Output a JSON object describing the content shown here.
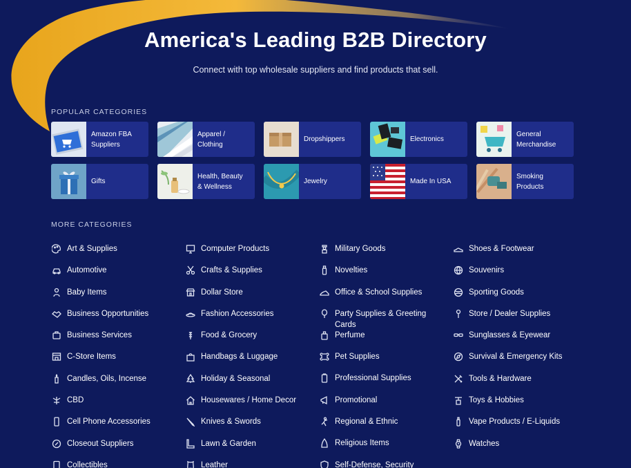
{
  "hero": {
    "title": "America's Leading B2B Directory",
    "subtitle": "Connect with top wholesale suppliers and find products that sell."
  },
  "popular": {
    "label": "POPULAR CATEGORIES",
    "items": [
      {
        "label": "Amazon FBA\nSuppliers",
        "thumb": "laptop-cart-image"
      },
      {
        "label": "Apparel /\nClothing",
        "thumb": "folded-shirts-image"
      },
      {
        "label": "Dropshippers",
        "thumb": "cardboard-box-image"
      },
      {
        "label": "Electronics",
        "thumb": "electronics-image"
      },
      {
        "label": "General\nMerchandise",
        "thumb": "shopping-cart-image"
      },
      {
        "label": "Gifts",
        "thumb": "gift-box-image"
      },
      {
        "label": "Health, Beauty\n& Wellness",
        "thumb": "beauty-products-image"
      },
      {
        "label": "Jewelry",
        "thumb": "necklace-image"
      },
      {
        "label": "Made In USA",
        "thumb": "us-flag-image"
      },
      {
        "label": "Smoking\nProducts",
        "thumb": "smoking-products-image"
      }
    ]
  },
  "more": {
    "label": "MORE CATEGORIES",
    "columns": [
      [
        {
          "label": "Art & Supplies",
          "icon": "palette-icon"
        },
        {
          "label": "Automotive",
          "icon": "car-icon"
        },
        {
          "label": "Baby Items",
          "icon": "baby-icon"
        },
        {
          "label": "Business Opportunities",
          "icon": "handshake-icon"
        },
        {
          "label": "Business Services",
          "icon": "briefcase-icon"
        },
        {
          "label": "C-Store Items",
          "icon": "store-icon"
        },
        {
          "label": "Candles, Oils, Incense",
          "icon": "candle-icon"
        },
        {
          "label": "CBD",
          "icon": "leaf-icon"
        },
        {
          "label": "Cell Phone Accessories",
          "icon": "phone-icon"
        },
        {
          "label": "Closeout Suppliers",
          "icon": "tag-icon"
        },
        {
          "label": "Collectibles",
          "icon": "collectible-icon"
        }
      ],
      [
        {
          "label": "Computer Products",
          "icon": "monitor-icon"
        },
        {
          "label": "Crafts & Supplies",
          "icon": "scissors-icon"
        },
        {
          "label": "Dollar Store",
          "icon": "shop-icon"
        },
        {
          "label": "Fashion Accessories",
          "icon": "hat-icon"
        },
        {
          "label": "Food & Grocery",
          "icon": "wheat-icon"
        },
        {
          "label": "Handbags & Luggage",
          "icon": "bag-icon"
        },
        {
          "label": "Holiday & Seasonal",
          "icon": "tree-icon"
        },
        {
          "label": "Housewares / Home Decor",
          "icon": "home-icon"
        },
        {
          "label": "Knives & Swords",
          "icon": "knife-icon"
        },
        {
          "label": "Lawn & Garden",
          "icon": "boot-icon"
        },
        {
          "label": "Leather",
          "icon": "leather-icon"
        }
      ],
      [
        {
          "label": "Military Goods",
          "icon": "soldier-icon"
        },
        {
          "label": "Novelties",
          "icon": "bottle-icon"
        },
        {
          "label": "Office & School Supplies",
          "icon": "shoe-icon"
        },
        {
          "label": "Party Supplies & Greeting\nCards",
          "icon": "balloon-icon"
        },
        {
          "label": "Perfume",
          "icon": "perfume-icon"
        },
        {
          "label": "Pet Supplies",
          "icon": "bone-icon"
        },
        {
          "label": "Professional Supplies",
          "icon": "clipboard-icon"
        },
        {
          "label": "Promotional",
          "icon": "megaphone-icon"
        },
        {
          "label": "Regional & Ethnic",
          "icon": "dancer-icon"
        },
        {
          "label": "Religious Items",
          "icon": "temple-icon"
        },
        {
          "label": "Self-Defense, Security",
          "icon": "shield-icon"
        }
      ],
      [
        {
          "label": "Shoes & Footwear",
          "icon": "sneaker-icon"
        },
        {
          "label": "Souvenirs",
          "icon": "globe-icon"
        },
        {
          "label": "Sporting Goods",
          "icon": "ball-icon"
        },
        {
          "label": "Store / Dealer Supplies",
          "icon": "pin-icon"
        },
        {
          "label": "Sunglasses & Eyewear",
          "icon": "glasses-icon"
        },
        {
          "label": "Survival & Emergency Kits",
          "icon": "compass-icon"
        },
        {
          "label": "Tools & Hardware",
          "icon": "tools-icon"
        },
        {
          "label": "Toys & Hobbies",
          "icon": "toy-icon"
        },
        {
          "label": "Vape Products / E-Liquids",
          "icon": "vape-icon"
        },
        {
          "label": "Watches",
          "icon": "watch-icon"
        }
      ]
    ]
  },
  "colors": {
    "background": "#0e1a5c",
    "card": "#1f2d8a",
    "accent": "#f0b429"
  }
}
